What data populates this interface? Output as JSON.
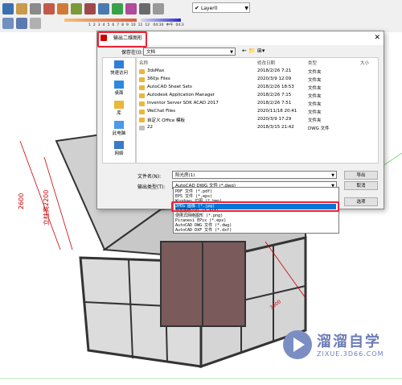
{
  "toolbar": {
    "layer_value": "Layer0",
    "slider_labels": [
      "1",
      "2",
      "3",
      "4",
      "5",
      "6",
      "7",
      "8",
      "9",
      "10",
      "11",
      "12"
    ],
    "time_labels": [
      "04:30",
      "中午",
      "04:3"
    ]
  },
  "dialog": {
    "title": "输出二维图形",
    "save_in_label": "保存在(I):",
    "save_in_value": "文档",
    "places": [
      "快速访问",
      "桌面",
      "库",
      "此电脑",
      "网络"
    ],
    "columns": {
      "name": "名称",
      "date": "修改日期",
      "type": "类型",
      "size": "大小"
    },
    "files": [
      {
        "name": "3dsMax",
        "date": "2018/2/26 7:21",
        "type": "文件夹",
        "size": ""
      },
      {
        "name": "360js Files",
        "date": "2020/3/9 12:09",
        "type": "文件夹",
        "size": ""
      },
      {
        "name": "AutoCAD Sheet Sets",
        "date": "2018/2/26 18:53",
        "type": "文件夹",
        "size": ""
      },
      {
        "name": "Autodesk Application Manager",
        "date": "2018/2/26 7:15",
        "type": "文件夹",
        "size": ""
      },
      {
        "name": "Inventor Server SDK ACAD 2017",
        "date": "2018/2/26 7:51",
        "type": "文件夹",
        "size": ""
      },
      {
        "name": "WeChat Files",
        "date": "2020/11/18 20:41",
        "type": "文件夹",
        "size": ""
      },
      {
        "name": "自定义 Office 模板",
        "date": "2020/3/9 17:29",
        "type": "文件夹",
        "size": ""
      },
      {
        "name": "22",
        "date": "2018/3/15 21:42",
        "type": "DWG 文件",
        "size": ""
      }
    ],
    "filename_label": "文件名(N):",
    "filename_value": "阳光房(1)",
    "filetype_label": "输出类型(T):",
    "filetype_value": "AutoCAD DWG 文件 (*.dwg)",
    "export_button": "导出",
    "cancel_button": "取消",
    "options_button": "选项",
    "type_options": [
      "PDF 文件 (*.pdf)",
      "EPS 文件 (*.eps)",
      "Windows 位图 (*.bmp)",
      "JPEG 图像 (*.jpg)",
      "标签图像文件 (*.tif)",
      "便携式网络图形 (*.png)",
      "Piranesi EPix (*.epx)",
      "AutoCAD DWG 文件 (*.dwg)",
      "AutoCAD DXF 文件 (*.dxf)"
    ],
    "selected_option_index": 3
  },
  "canvas": {
    "dim_left": "2600",
    "dim_inner": "立柱高2200",
    "dim_right": "3600"
  },
  "watermark": {
    "title": "溜溜自学",
    "subtitle": "ZIXUE.3D66.COM"
  },
  "colors": {
    "highlight": "#e23030",
    "selection": "#0078d7",
    "watermark": "#6b7db8"
  }
}
